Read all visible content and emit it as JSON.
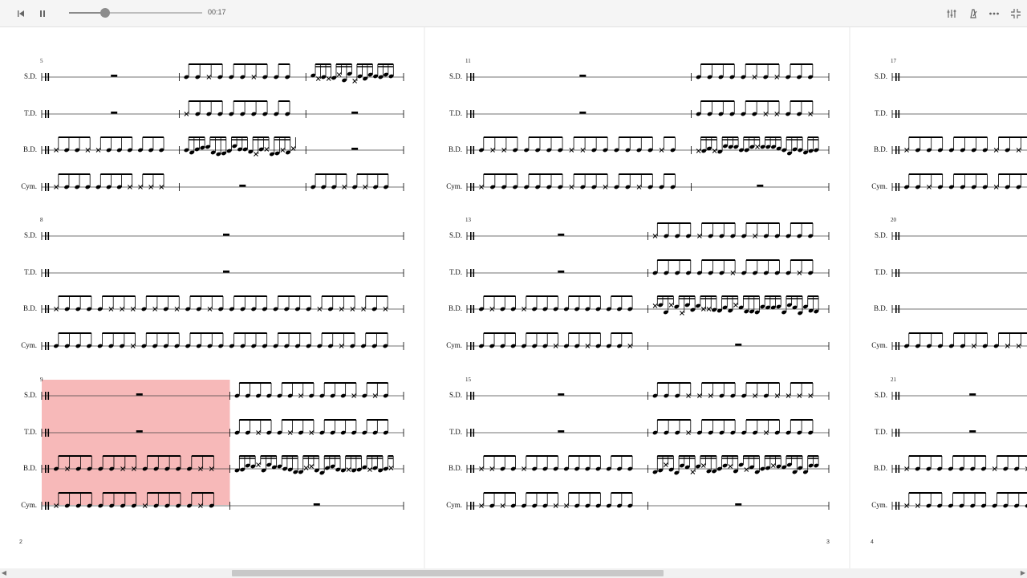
{
  "toolbar": {
    "time": "00:17",
    "progress": 0.27,
    "left_icons": [
      "skip-back-icon",
      "pause-icon"
    ],
    "right_icons": [
      "mixer-icon",
      "metronome-icon",
      "more-icon",
      "fullscreen-exit-icon"
    ]
  },
  "instruments": [
    "S.D.",
    "T.D.",
    "B.D.",
    "Cym."
  ],
  "pages": [
    {
      "page_number": "2",
      "systems": [
        {
          "measure_number": "5",
          "measures": 3
        },
        {
          "measure_number": "8",
          "measures": 1
        },
        {
          "measure_number": "9",
          "measures": 2,
          "highlighted_measure": 1
        }
      ]
    },
    {
      "page_number": "3",
      "systems": [
        {
          "measure_number": "11",
          "measures": 2
        },
        {
          "measure_number": "13",
          "measures": 2
        },
        {
          "measure_number": "15",
          "measures": 2
        }
      ]
    },
    {
      "page_number": "4",
      "systems": [
        {
          "measure_number": "17",
          "measures": 1
        },
        {
          "measure_number": "20",
          "measures": 1
        },
        {
          "measure_number": "21",
          "measures": 2
        }
      ]
    }
  ],
  "highlight_color": "#f7b9b9",
  "scrollbar": {
    "thumb_start": 0.226,
    "thumb_fraction": 0.42
  }
}
